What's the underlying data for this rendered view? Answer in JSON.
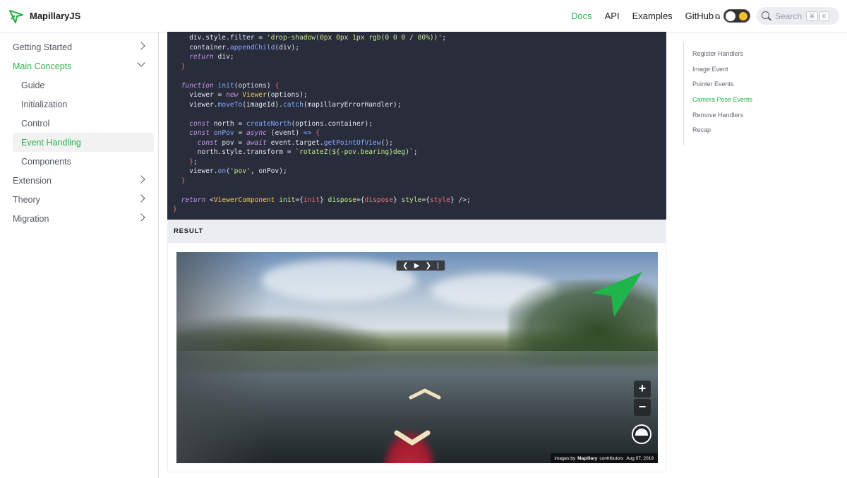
{
  "navbar": {
    "brand": "MapillaryJS",
    "links": [
      "Docs",
      "API",
      "Examples",
      "GitHub"
    ],
    "search_placeholder": "Search",
    "search_keys": [
      "⌘",
      "K"
    ]
  },
  "sidebar": {
    "items": [
      {
        "label": "Getting Started",
        "level": "top",
        "chevron": "right"
      },
      {
        "label": "Main Concepts",
        "level": "top",
        "chevron": "down",
        "active": true
      },
      {
        "label": "Guide",
        "level": "sub"
      },
      {
        "label": "Initialization",
        "level": "sub"
      },
      {
        "label": "Control",
        "level": "sub"
      },
      {
        "label": "Event Handling",
        "level": "sub",
        "active": true
      },
      {
        "label": "Components",
        "level": "sub"
      },
      {
        "label": "Extension",
        "level": "top",
        "chevron": "right"
      },
      {
        "label": "Theory",
        "level": "top",
        "chevron": "right"
      },
      {
        "label": "Migration",
        "level": "top",
        "chevron": "right"
      }
    ]
  },
  "result": {
    "label": "RESULT",
    "attribution_prefix": "images by",
    "attribution_brand": "Mapillary",
    "attribution_suffix": "contributors",
    "date": "Aug 07, 2019",
    "zoom_in": "+",
    "zoom_out": "−"
  },
  "toc": {
    "items": [
      "Register Handlers",
      "Image Event",
      "Pointer Events",
      "Camera Pose Events",
      "Remove Handlers",
      "Recap"
    ],
    "active_index": 3
  },
  "colors": {
    "accent": "#2bb24c",
    "code_bg": "#282c3b"
  }
}
